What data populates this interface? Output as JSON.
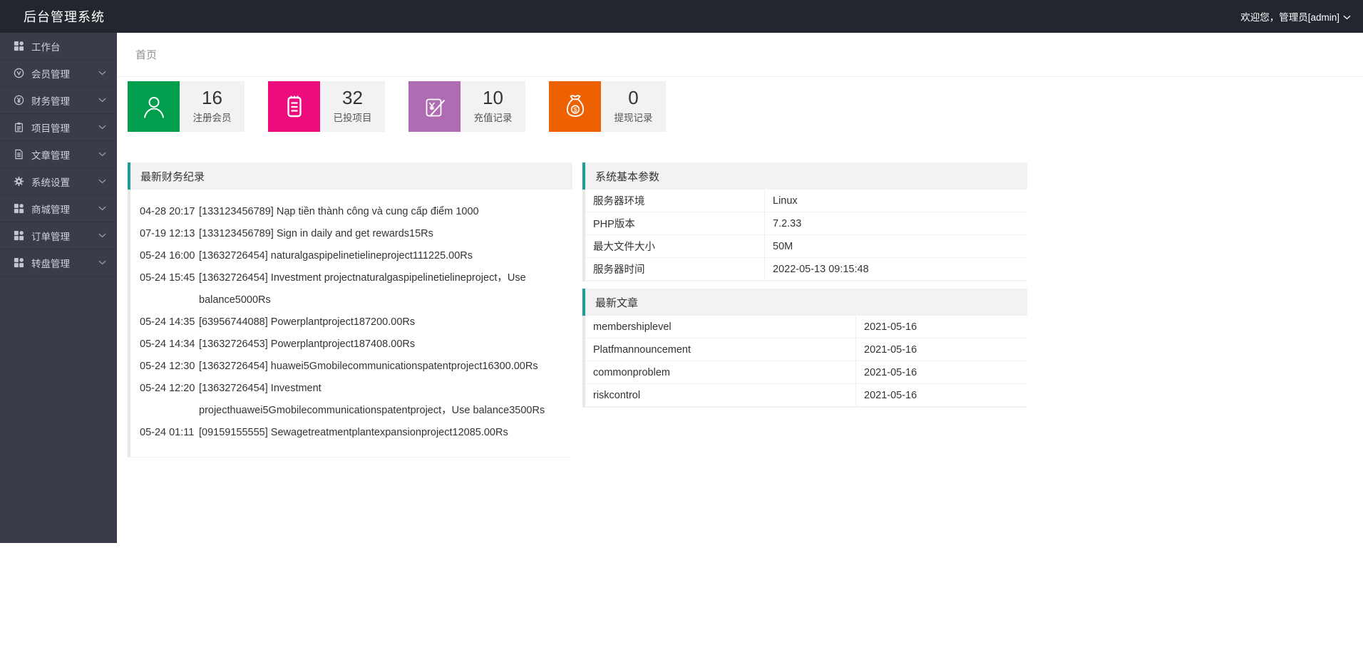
{
  "topbar": {
    "title": "后台管理系统",
    "welcome_text": "欢迎您，管理员[admin]"
  },
  "sidebar": {
    "items": [
      {
        "label": "工作台",
        "icon": "grid-icon",
        "expandable": false
      },
      {
        "label": "会员管理",
        "icon": "member-icon",
        "expandable": true
      },
      {
        "label": "财务管理",
        "icon": "finance-icon",
        "expandable": true
      },
      {
        "label": "项目管理",
        "icon": "project-icon",
        "expandable": true
      },
      {
        "label": "文章管理",
        "icon": "article-icon",
        "expandable": true
      },
      {
        "label": "系统设置",
        "icon": "settings-icon",
        "expandable": true
      },
      {
        "label": "商城管理",
        "icon": "grid-icon",
        "expandable": true
      },
      {
        "label": "订单管理",
        "icon": "grid-icon",
        "expandable": true
      },
      {
        "label": "转盘管理",
        "icon": "grid-icon",
        "expandable": true
      }
    ]
  },
  "breadcrumb": {
    "home": "首页"
  },
  "stat_cards": [
    {
      "value": "16",
      "label": "注册会员",
      "icon": "user-icon",
      "color": "#009E4D"
    },
    {
      "value": "32",
      "label": "已投项目",
      "icon": "invest-icon",
      "color": "#EC0C7D"
    },
    {
      "value": "10",
      "label": "充值记录",
      "icon": "recharge-icon",
      "color": "#B06CB2"
    },
    {
      "value": "0",
      "label": "提现记录",
      "icon": "withdraw-icon",
      "color": "#EE6102"
    }
  ],
  "finance_panel": {
    "title": "最新财务纪录",
    "records": [
      {
        "time": "04-28 20:17",
        "text": "[133123456789] Nạp tiền thành công và cung cấp điểm 1000"
      },
      {
        "time": "07-19 12:13",
        "text": "[133123456789] Sign in daily and get rewards15Rs"
      },
      {
        "time": "05-24 16:00",
        "text": "[13632726454] naturalgaspipelinetielineproject111225.00Rs"
      },
      {
        "time": "05-24 15:45",
        "text": "[13632726454] Investment projectnaturalgaspipelinetielineproject，Use balance5000Rs"
      },
      {
        "time": "05-24 14:35",
        "text": "[63956744088] Powerplantproject187200.00Rs"
      },
      {
        "time": "05-24 14:34",
        "text": "[13632726453] Powerplantproject187408.00Rs"
      },
      {
        "time": "05-24 12:30",
        "text": "[13632726454] huawei5Gmobilecommunicationspatentproject16300.00Rs"
      },
      {
        "time": "05-24 12:20",
        "text": "[13632726454] Investment projecthuawei5Gmobilecommunicationspatentproject，Use balance3500Rs"
      },
      {
        "time": "05-24 01:11",
        "text": "[09159155555] Sewagetreatmentplantexpansionproject12085.00Rs"
      }
    ]
  },
  "system_panel": {
    "title": "系统基本参数",
    "rows": [
      {
        "label": "服务器环境",
        "value": "Linux"
      },
      {
        "label": "PHP版本",
        "value": "7.2.33"
      },
      {
        "label": "最大文件大小",
        "value": "50M"
      },
      {
        "label": "服务器时间",
        "value": "2022-05-13 09:15:48"
      }
    ]
  },
  "articles_panel": {
    "title": "最新文章",
    "rows": [
      {
        "label": "membershiplevel",
        "value": "2021-05-16"
      },
      {
        "label": "Platfmannouncement",
        "value": "2021-05-16"
      },
      {
        "label": "commonproblem",
        "value": "2021-05-16"
      },
      {
        "label": "riskcontrol",
        "value": "2021-05-16"
      }
    ]
  },
  "colors": {
    "topbar_bg": "#23262E",
    "sidebar_bg": "#393D49",
    "panel_accent": "#1AA094"
  }
}
